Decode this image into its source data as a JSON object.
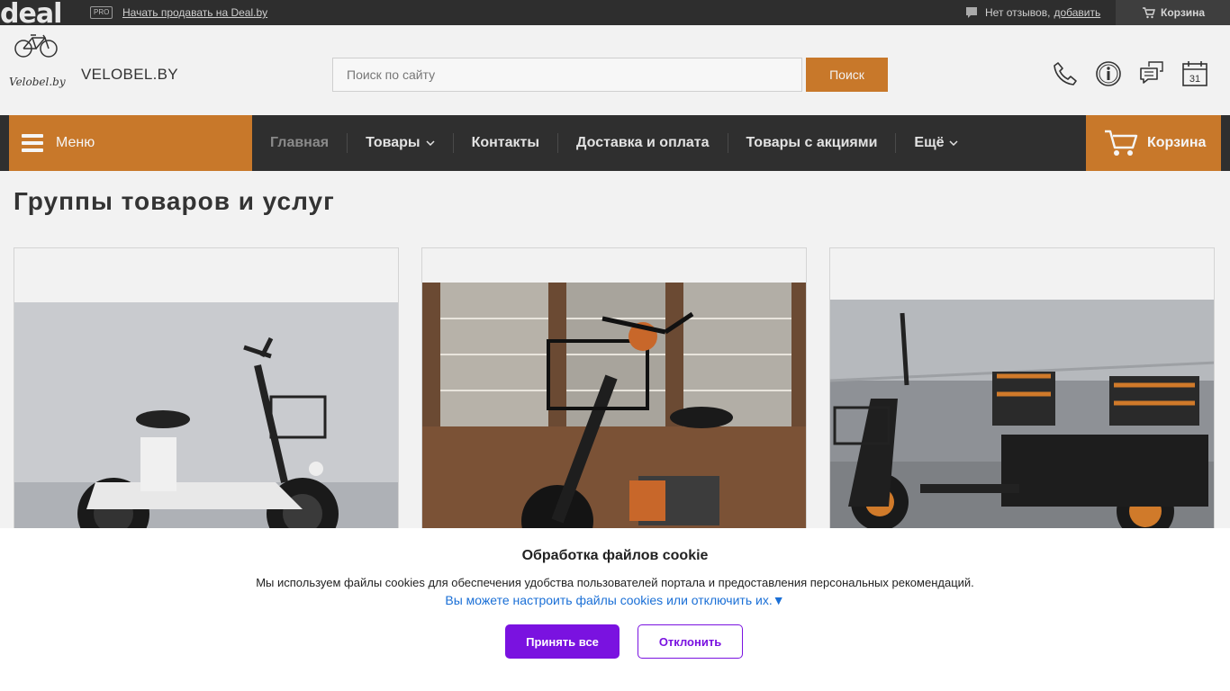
{
  "topbar": {
    "logo": "deal",
    "pro": "PRO",
    "sell_link": "Начать продавать на Deal.by",
    "reviews_text": "Нет отзывов,",
    "reviews_add": "добавить",
    "cart": "Корзина"
  },
  "header": {
    "site_name": "VELOBEL.BY",
    "logo_text": "Velobel.by",
    "search_placeholder": "Поиск по сайту",
    "search_button": "Поиск",
    "calendar_day": "31",
    "icons": [
      "phone-icon",
      "info-icon",
      "chat-icon",
      "calendar-icon"
    ]
  },
  "nav": {
    "menu": "Меню",
    "items": [
      {
        "label": "Главная"
      },
      {
        "label": "Товары"
      },
      {
        "label": "Контакты"
      },
      {
        "label": "Доставка и оплата"
      },
      {
        "label": "Товары с акциями"
      },
      {
        "label": "Ещё"
      }
    ],
    "cart": "Корзина"
  },
  "main": {
    "title": "Группы товаров и услуг"
  },
  "cookie": {
    "title": "Обработка файлов cookie",
    "text": "Мы используем файлы cookies для обеспечения удобства пользователей портала и предоставления персональных рекомендаций.",
    "link": "Вы можете настроить файлы cookies или отключить их.▼",
    "accept": "Принять все",
    "decline": "Отклонить"
  },
  "colors": {
    "accent": "#c8782a",
    "dark": "#2f2f2f",
    "cookie_primary": "#7a12e0",
    "link": "#1a6fd6"
  }
}
